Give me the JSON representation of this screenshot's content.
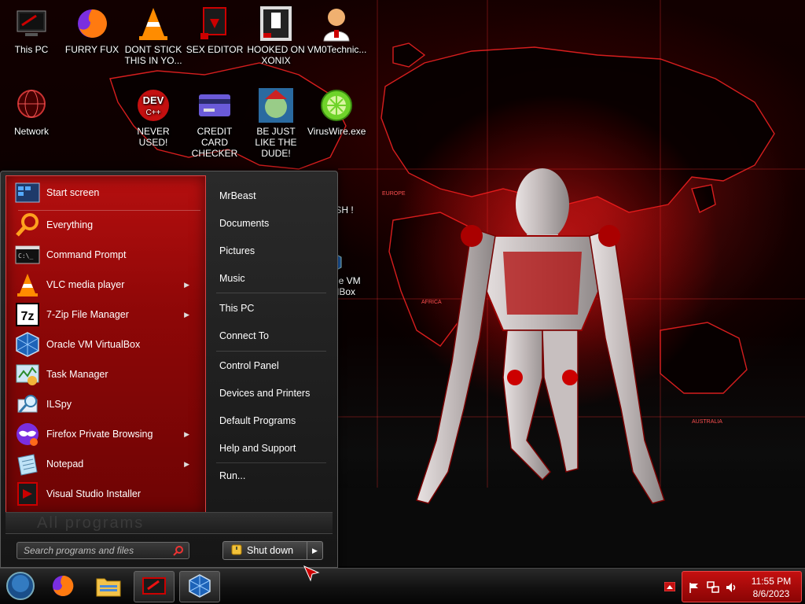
{
  "desktop": {
    "icons": [
      {
        "label": "This PC"
      },
      {
        "label": "FURRY FUX"
      },
      {
        "label": "DONT STICK THIS IN YO..."
      },
      {
        "label": "SEX EDITOR"
      },
      {
        "label": "HOOKED ON XONIX"
      },
      {
        "label": "VM0Technic..."
      },
      {
        "label": "Network"
      },
      {
        "label": "NEVER USED!"
      },
      {
        "label": "CREDIT CARD CHECKER"
      },
      {
        "label": "BE JUST LIKE THE DUDE!"
      },
      {
        "label": "VirusWire.exe"
      }
    ],
    "partial_labels": {
      "flash": "FLASH !",
      "vbox": "acle VM\nalBox"
    }
  },
  "start_menu": {
    "programs": [
      {
        "label": "Start screen",
        "icon": "start-screen-icon",
        "submenu": false
      },
      {
        "label": "Everything",
        "icon": "magnifier-icon",
        "submenu": false
      },
      {
        "label": "Command Prompt",
        "icon": "terminal-icon",
        "submenu": false
      },
      {
        "label": "VLC media player",
        "icon": "vlc-cone-icon",
        "submenu": true
      },
      {
        "label": "7-Zip File Manager",
        "icon": "7zip-icon",
        "submenu": true
      },
      {
        "label": "Oracle VM VirtualBox",
        "icon": "virtualbox-icon",
        "submenu": false
      },
      {
        "label": "Task Manager",
        "icon": "task-manager-icon",
        "submenu": false
      },
      {
        "label": "ILSpy",
        "icon": "ilspy-icon",
        "submenu": false
      },
      {
        "label": "Firefox Private Browsing",
        "icon": "firefox-private-icon",
        "submenu": true
      },
      {
        "label": "Notepad",
        "icon": "notepad-icon",
        "submenu": true
      },
      {
        "label": "Visual Studio Installer",
        "icon": "visual-studio-icon",
        "submenu": false
      }
    ],
    "right_items": [
      {
        "label": "MrBeast"
      },
      {
        "label": "Documents"
      },
      {
        "label": "Pictures"
      },
      {
        "label": "Music"
      },
      {
        "label": "This PC"
      },
      {
        "label": "Connect To"
      },
      {
        "label": "Control Panel"
      },
      {
        "label": "Devices and Printers"
      },
      {
        "label": "Default Programs"
      },
      {
        "label": "Help and Support"
      },
      {
        "label": "Run..."
      }
    ],
    "all_programs": "All programs",
    "search_placeholder": "Search programs and files",
    "shutdown_label": "Shut down"
  },
  "taskbar": {
    "items": [
      {
        "icon": "start-orb-icon"
      },
      {
        "icon": "firefox-icon"
      },
      {
        "icon": "file-explorer-icon"
      },
      {
        "icon": "red-app-icon"
      },
      {
        "icon": "virtualbox-icon"
      }
    ],
    "clock_time": "11:55 PM",
    "clock_date": "8/6/2023"
  },
  "colors": {
    "accent_red": "#b50f0f",
    "tray_red": "#c41010"
  },
  "wallpaper": {
    "europe": "EUROPE",
    "africa": "AFRICA",
    "australia": "AUSTRALIA"
  }
}
